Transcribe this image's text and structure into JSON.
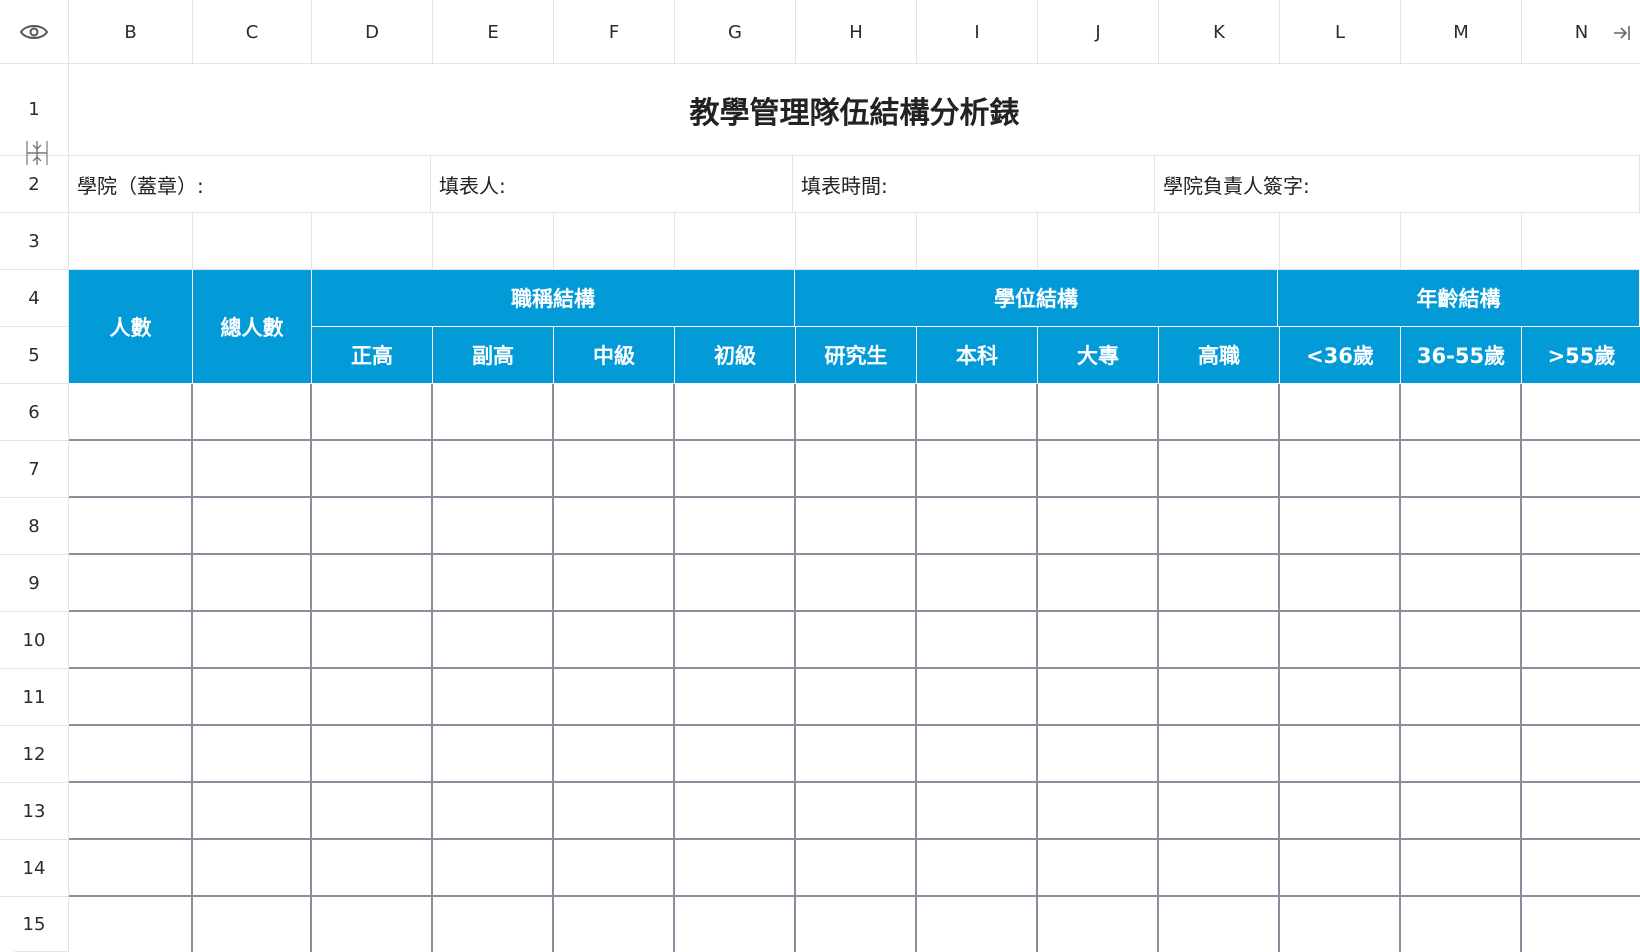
{
  "columns": [
    "B",
    "C",
    "D",
    "E",
    "F",
    "G",
    "H",
    "I",
    "J",
    "K",
    "L",
    "M",
    "N"
  ],
  "rows": [
    "1",
    "2",
    "3",
    "4",
    "5",
    "6",
    "7",
    "8",
    "9",
    "10",
    "11",
    "12",
    "13",
    "14",
    "15"
  ],
  "sheet": {
    "title": "教學管理隊伍結構分析錶",
    "info": {
      "college": "學院（蓋章）:",
      "filler": "填表人:",
      "fill_time": "填表時間:",
      "signature": "學院負責人簽字:"
    },
    "headers": {
      "count": "人數",
      "total": "總人數",
      "title_group": "職稱結構",
      "degree_group": "學位結構",
      "age_group": "年齡結構",
      "title_items": [
        "正高",
        "副高",
        "中級",
        "初級"
      ],
      "degree_items": [
        "研究生",
        "本科",
        "大專",
        "高職"
      ],
      "age_items": [
        "<36歲",
        "36-55歲",
        ">55歲"
      ]
    }
  },
  "colors": {
    "header_fill": "#039ad8",
    "grid_line": "#8a8d9c",
    "light_line": "#e3e3e8"
  },
  "icons": {
    "visibility": "eye-icon",
    "scroll_right": "arrow-right-icon",
    "row_resize": "row-resize-icon"
  }
}
